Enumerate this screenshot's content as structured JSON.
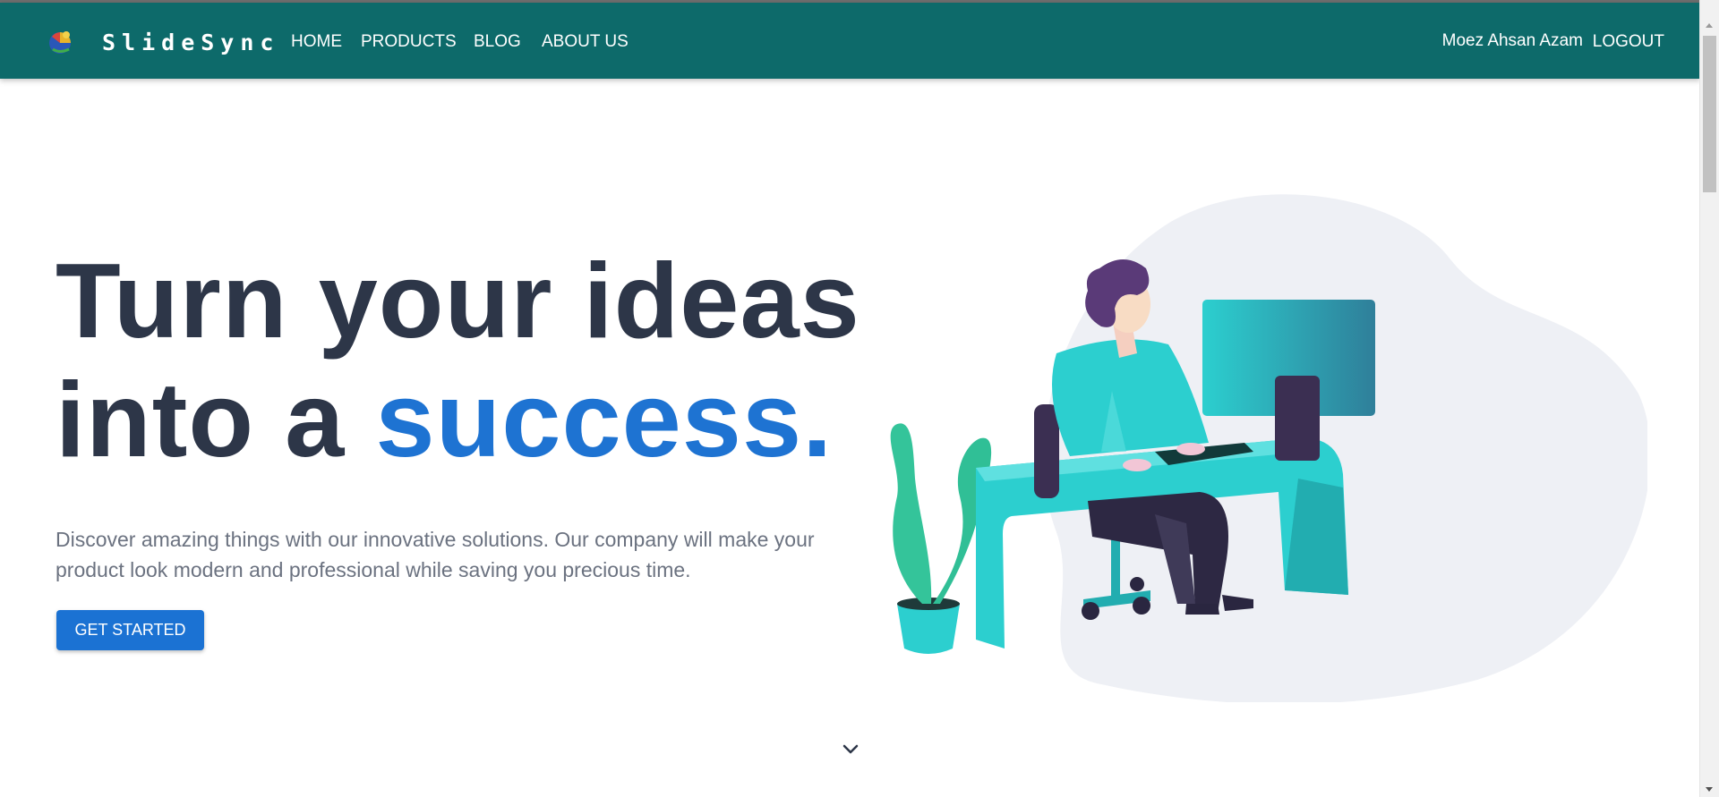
{
  "nav": {
    "brand": "SlideSync",
    "links": [
      "HOME",
      "PRODUCTS",
      "BLOG",
      "ABOUT US"
    ],
    "user": "Moez Ahsan Azam",
    "logout": "LOGOUT",
    "color": "#0d6a6a"
  },
  "hero": {
    "headline_line1": "Turn your ideas",
    "headline_line2_prefix": "into a ",
    "headline_accent": "success.",
    "description": "Discover amazing things with our innovative solutions. Our company will make your product look modern and professional while saving you precious time.",
    "cta": "GET STARTED",
    "accent_color": "#1e73d2",
    "heading_color": "#2d3648"
  },
  "icons": {
    "logo": "globe-logo-icon",
    "scroll_hint": "chevron-down-icon",
    "illustration": "person-at-desk-illustration"
  }
}
